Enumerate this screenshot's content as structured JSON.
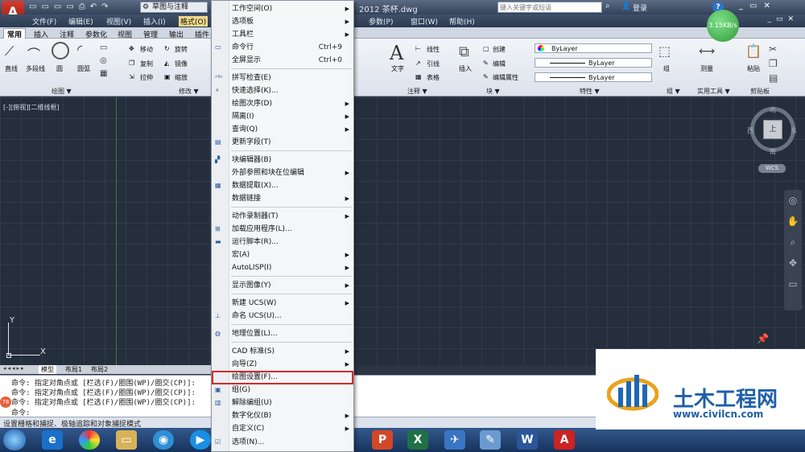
{
  "titlebar": {
    "workspace": "草图与注释",
    "app_title": "2012   茶杯.dwg",
    "search_placeholder": "键入关键字或短语",
    "login": "登录"
  },
  "menubar": {
    "items": [
      "文件(F)",
      "编辑(E)",
      "视图(V)",
      "插入(I)",
      "格式(O)",
      "参数(P)",
      "窗口(W)",
      "帮助(H)"
    ]
  },
  "ribbon_tabs": [
    "常用",
    "插入",
    "注释",
    "参数化",
    "视图",
    "管理",
    "输出",
    "插件"
  ],
  "ribbon": {
    "draw_tools": [
      "直线",
      "多段线",
      "圆",
      "圆弧"
    ],
    "modify_tools": [
      "移动",
      "旋转",
      "复制",
      "镜像",
      "拉伸",
      "缩放"
    ],
    "panel_draw": "绘图 ▼",
    "panel_modify": "修改 ▼",
    "annotation": {
      "text": "文字",
      "linear": "线性",
      "leader": "引线",
      "table": "表格",
      "panel": "注释 ▼"
    },
    "block": {
      "insert": "插入",
      "create": "创建",
      "edit": "编辑",
      "edit_attr": "编辑属性",
      "panel": "块 ▼"
    },
    "properties": {
      "layer1": "ByLayer",
      "layer2": "ByLayer",
      "layer3": "ByLayer",
      "panel": "特性 ▼"
    },
    "group": {
      "label": "组",
      "panel": "组 ▼"
    },
    "utilities": {
      "measure": "测量",
      "panel": "实用工具 ▼"
    },
    "clipboard": {
      "paste": "粘贴",
      "panel": "剪贴板"
    }
  },
  "viewport": {
    "label": "[-][俯视][二维线框]",
    "compass_n": "北",
    "compass_s": "南",
    "compass_e": "东",
    "compass_w": "西",
    "compass_center": "上",
    "wcs": "WCS",
    "speed": "3.15KB/s",
    "axis_y": "Y",
    "axis_x": "X"
  },
  "layout_tabs": [
    "模型",
    "布局1",
    "布局2"
  ],
  "command_lines": [
    "命令: 指定对角点或 [栏选(F)/圈围(WP)/圈交(CP)]:",
    "命令: 指定对角点或 [栏选(F)/圈围(WP)/圈交(CP)]:",
    "命令: 指定对角点或 [栏选(F)/圈围(WP)/圈交(CP)]:",
    "命令:"
  ],
  "status_text": "设置栅格和捕捉、极轴追踪和对象捕捉模式",
  "taskbar_badge": "78",
  "watermark": {
    "cn": "土木工程网",
    "url": "www.civilcn.com"
  },
  "menu": {
    "items": [
      {
        "label": "工作空间(O)",
        "sub": true,
        "sc": ""
      },
      {
        "label": "选项板",
        "sub": true,
        "sc": ""
      },
      {
        "label": "工具栏",
        "sub": true,
        "sc": ""
      },
      {
        "label": "命令行",
        "sub": false,
        "sc": "Ctrl+9"
      },
      {
        "label": "全屏显示",
        "sub": false,
        "sc": "Ctrl+0"
      },
      {
        "label": "拼写检查(E)",
        "sub": false,
        "sc": ""
      },
      {
        "label": "快速选择(K)...",
        "sub": false,
        "sc": ""
      },
      {
        "label": "绘图次序(D)",
        "sub": true,
        "sc": ""
      },
      {
        "label": "隔离(I)",
        "sub": true,
        "sc": ""
      },
      {
        "label": "查询(Q)",
        "sub": true,
        "sc": ""
      },
      {
        "label": "更新字段(T)",
        "sub": false,
        "sc": ""
      },
      {
        "label": "块编辑器(B)",
        "sub": false,
        "sc": ""
      },
      {
        "label": "外部参照和块在位编辑",
        "sub": true,
        "sc": ""
      },
      {
        "label": "数据提取(X)...",
        "sub": false,
        "sc": ""
      },
      {
        "label": "数据链接",
        "sub": true,
        "sc": ""
      },
      {
        "label": "动作录制器(T)",
        "sub": true,
        "sc": ""
      },
      {
        "label": "加载应用程序(L)...",
        "sub": false,
        "sc": ""
      },
      {
        "label": "运行脚本(R)...",
        "sub": false,
        "sc": ""
      },
      {
        "label": "宏(A)",
        "sub": true,
        "sc": ""
      },
      {
        "label": "AutoLISP(I)",
        "sub": true,
        "sc": ""
      },
      {
        "label": "显示图像(Y)",
        "sub": true,
        "sc": ""
      },
      {
        "label": "新建 UCS(W)",
        "sub": true,
        "sc": ""
      },
      {
        "label": "命名 UCS(U)...",
        "sub": false,
        "sc": ""
      },
      {
        "label": "地理位置(L)...",
        "sub": false,
        "sc": ""
      },
      {
        "label": "CAD 标准(S)",
        "sub": true,
        "sc": ""
      },
      {
        "label": "向导(Z)",
        "sub": true,
        "sc": ""
      },
      {
        "label": "绘图设置(F)...",
        "sub": false,
        "sc": ""
      },
      {
        "label": "组(G)",
        "sub": false,
        "sc": ""
      },
      {
        "label": "解除编组(U)",
        "sub": false,
        "sc": ""
      },
      {
        "label": "数字化仪(B)",
        "sub": true,
        "sc": ""
      },
      {
        "label": "自定义(C)",
        "sub": true,
        "sc": ""
      },
      {
        "label": "选项(N)...",
        "sub": false,
        "sc": ""
      }
    ]
  }
}
